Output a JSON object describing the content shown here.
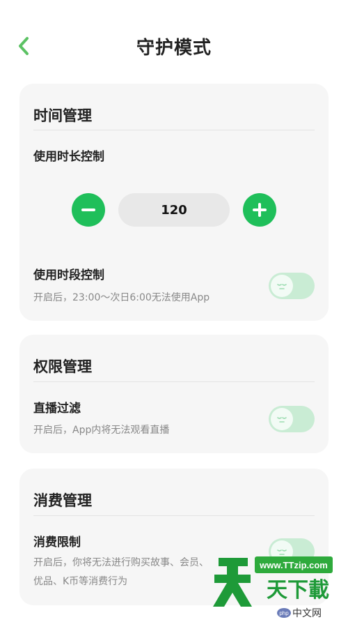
{
  "header": {
    "title": "守护模式",
    "back_icon": "chevron-left-icon",
    "accent": "#5cc264"
  },
  "cards": [
    {
      "title": "时间管理",
      "items": [
        {
          "label": "使用时长控制"
        },
        {
          "label": "使用时段控制",
          "desc": "开启后，23:00～次日6:00无法使用App",
          "toggle_on": false
        }
      ],
      "stepper": {
        "value": "120",
        "minus_icon": "minus-icon",
        "plus_icon": "plus-icon"
      }
    },
    {
      "title": "权限管理",
      "items": [
        {
          "label": "直播过滤",
          "desc": "开启后，App内将无法观看直播",
          "toggle_on": false
        }
      ]
    },
    {
      "title": "消费管理",
      "items": [
        {
          "label": "消费限制",
          "desc_line1": "开启后，你将无法进行购买故事、会员、",
          "desc_line2": "优品、K币等消费行为",
          "toggle_on": false
        }
      ]
    }
  ],
  "colors": {
    "green": "#1fbf5a",
    "toggle_track": "#c9ecd4",
    "card_bg": "#f6f6f6"
  },
  "watermark": {
    "url": "www.TTzip.com",
    "brand": "天天下载",
    "site": "中文网"
  }
}
